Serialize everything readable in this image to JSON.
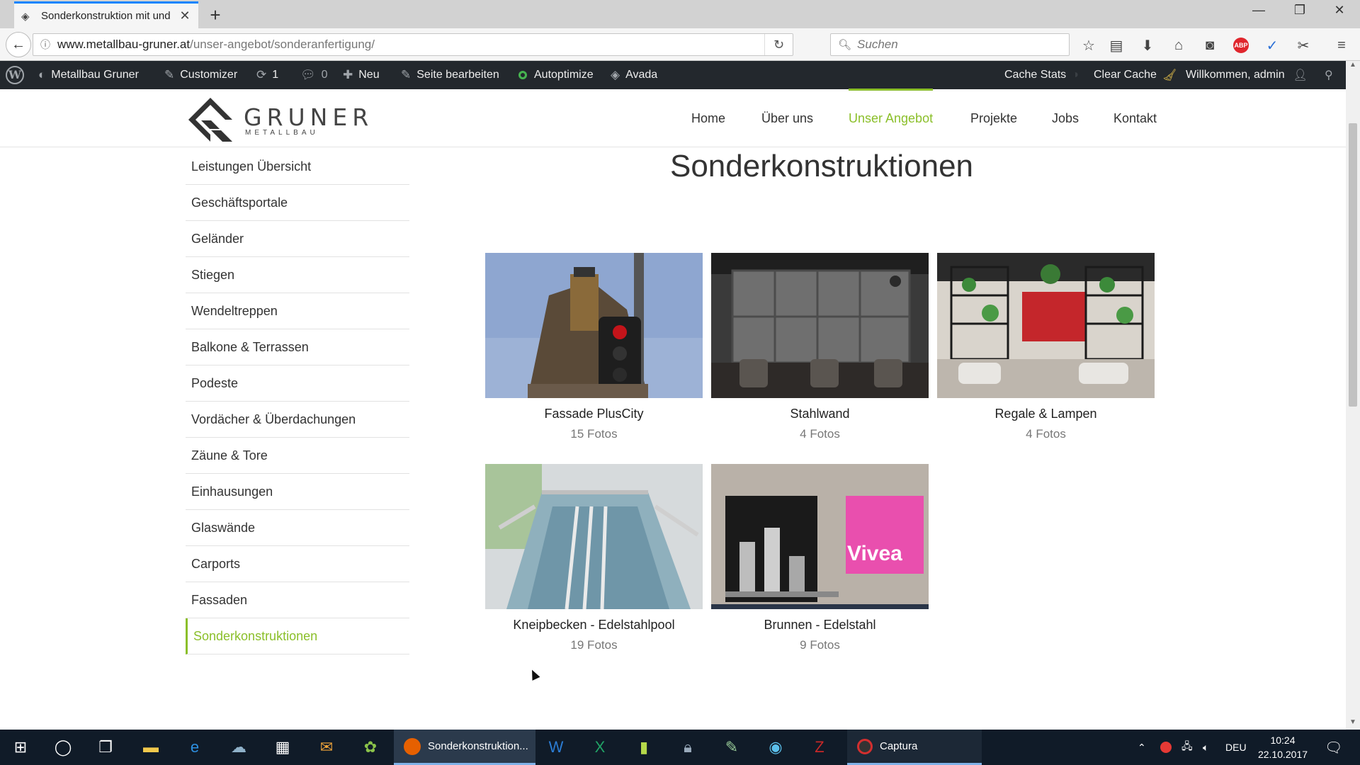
{
  "browser": {
    "tab_title": "Sonderkonstruktion mit und",
    "url_host": "www.metallbau-gruner.at",
    "url_path": "/unser-angebot/sonderanfertigung/",
    "search_placeholder": "Suchen"
  },
  "adminbar": {
    "site_name": "Metallbau Gruner",
    "customizer": "Customizer",
    "updates_count": "1",
    "comments_count": "0",
    "new_label": "Neu",
    "edit_page": "Seite bearbeiten",
    "autoptimize": "Autoptimize",
    "avada": "Avada",
    "cache_stats": "Cache Stats",
    "clear_cache": "Clear Cache",
    "welcome": "Willkommen, admin"
  },
  "site": {
    "logo_word": "GRUNER",
    "logo_sub": "METALLBAU",
    "nav": [
      "Home",
      "Über uns",
      "Unser Angebot",
      "Projekte",
      "Jobs",
      "Kontakt"
    ],
    "nav_active_index": 2,
    "accent_color": "#8bbf2a"
  },
  "sidebar": {
    "items": [
      "Leistungen Übersicht",
      "Geschäftsportale",
      "Geländer",
      "Stiegen",
      "Wendeltreppen",
      "Balkone & Terrassen",
      "Podeste",
      "Vordächer & Überdachungen",
      "Zäune & Tore",
      "Einhausungen",
      "Glaswände",
      "Carports",
      "Fassaden",
      "Sonderkonstruktionen"
    ],
    "current_index": 13
  },
  "main": {
    "title": "Sonderkonstruktionen",
    "galleries": [
      {
        "title": "Fassade PlusCity",
        "count": "15 Fotos"
      },
      {
        "title": "Stahlwand",
        "count": "4 Fotos"
      },
      {
        "title": "Regale & Lampen",
        "count": "4 Fotos"
      },
      {
        "title": "Kneipbecken - Edelstahlpool",
        "count": "19 Fotos"
      },
      {
        "title": "Brunnen - Edelstahl",
        "count": "9 Fotos"
      }
    ]
  },
  "taskbar": {
    "firefox_label": "Sonderkonstruktion...",
    "captura_label": "Captura",
    "language": "DEU",
    "time": "10:24",
    "date": "22.10.2017"
  }
}
